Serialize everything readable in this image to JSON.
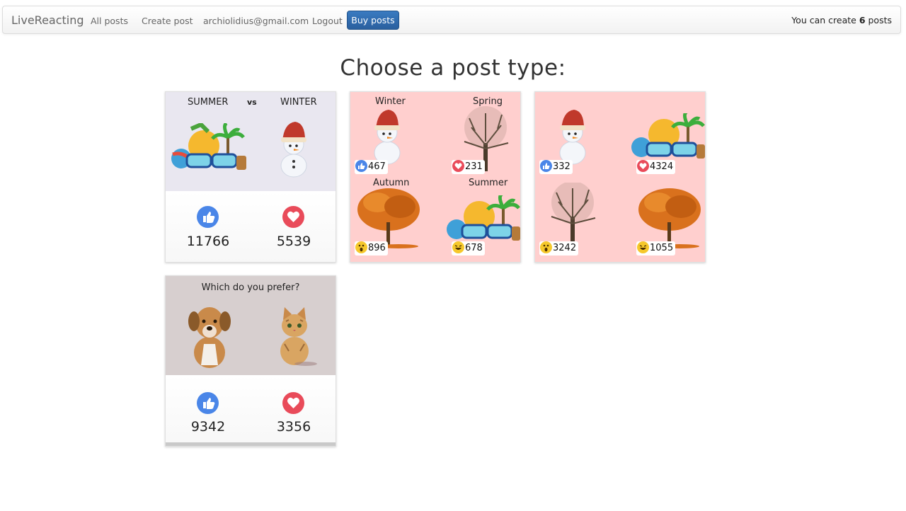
{
  "nav": {
    "brand": "LiveReacting",
    "all_posts": "All posts",
    "create_post": "Create post",
    "email": "archiolidius@gmail.com",
    "logout": "Logout",
    "buy_posts": "Buy posts",
    "quota_prefix": "You can create ",
    "quota_count": "6",
    "quota_suffix": " posts"
  },
  "page": {
    "title": "Choose a post type:"
  },
  "cards": {
    "summer_winter": {
      "label_left": "SUMMER",
      "label_mid": "vs",
      "label_right": "WINTER",
      "like_count": "11766",
      "love_count": "5539"
    },
    "seasons_labeled": {
      "labels": [
        "Winter",
        "Spring",
        "Autumn",
        "Summer"
      ],
      "counts": [
        "467",
        "231",
        "896",
        "678"
      ]
    },
    "seasons_plain": {
      "counts": [
        "332",
        "4324",
        "3242",
        "1055"
      ]
    },
    "dog_cat": {
      "question": "Which do you prefer?",
      "like_count": "9342",
      "love_count": "3356"
    }
  },
  "colors": {
    "like_blue": "#4a86e8",
    "love_red": "#e94b5a",
    "wow_yellow": "#f6c82b",
    "buy_button": "#2f6aad",
    "quad_bg": "#ffcfce",
    "summer_winter_bg": "#e9e7f0",
    "dog_cat_bg": "#d7cfcf"
  },
  "icons": [
    "like-icon",
    "love-icon",
    "wow-icon",
    "haha-icon",
    "snowman-image",
    "beach-image",
    "bare-tree-image",
    "autumn-tree-image",
    "dog-image",
    "cat-image"
  ]
}
